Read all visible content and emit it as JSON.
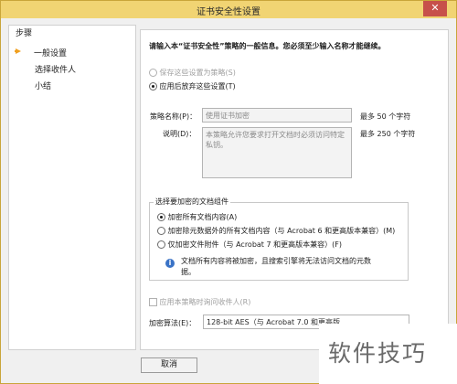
{
  "window": {
    "title": "证书安全性设置",
    "close_glyph": "✕"
  },
  "steps": {
    "header": "步骤",
    "items": [
      {
        "label": "一般设置",
        "active": true
      },
      {
        "label": "选择收件人"
      },
      {
        "label": "小结"
      }
    ]
  },
  "content": {
    "instruction": "请输入本“证书安全性”策略的一般信息。您必须至少输入名称才能继续。",
    "save_option": "保存这些设置为策略(S)",
    "apply_option": "应用后放弃这些设置(T)",
    "policy_name_label": "策略名称(P)：",
    "policy_name_placeholder": "使用证书加密",
    "policy_name_hint": "最多 50 个字符",
    "description_label": "说明(D)：",
    "description_placeholder": "本策略允许您要求打开文档时必须访问特定私钥。",
    "description_hint": "最多 250 个字符",
    "group_title": "选择要加密的文档组件",
    "encrypt_options": [
      "加密所有文档内容(A)",
      "加密除元数据外的所有文档内容（与 Acrobat 6 和更高版本兼容）(M)",
      "仅加密文件附件（与 Acrobat 7 和更高版本兼容）(F)"
    ],
    "info_text_line1": "文档所有内容将被加密，且搜索引擎将无法访问文档的元数",
    "info_text_line2": "据。",
    "ask_recipients": "应用本策略时询问收件人(R)",
    "algorithm_label": "加密算法(E)：",
    "algorithm_value": "128-bit AES（与 Acrobat 7.0 和更高版"
  },
  "buttons": {
    "cancel": "取消"
  },
  "watermark": "软件技巧"
}
